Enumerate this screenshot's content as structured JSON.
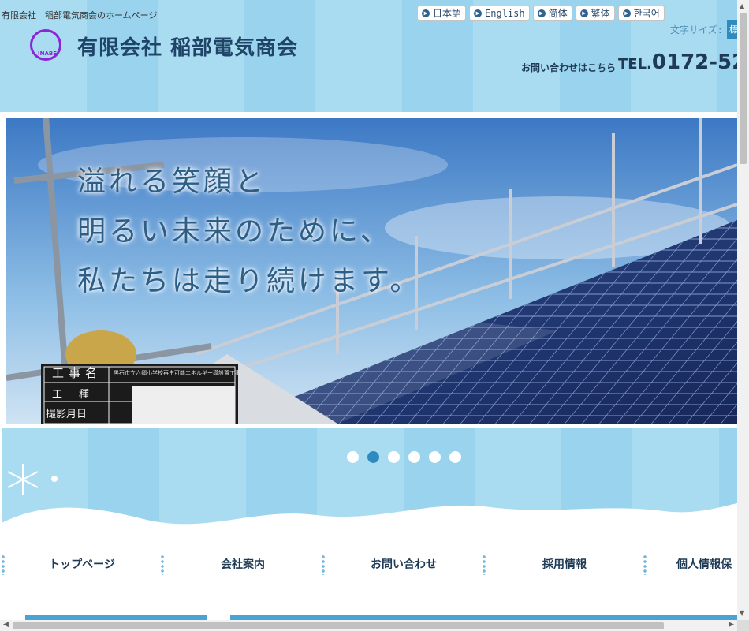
{
  "header": {
    "tagline": "有限会社　稲部電気商会のホームページ",
    "logo_text": "INABE",
    "company_name": "有限会社 稲部電気商会",
    "languages": [
      {
        "label": "日本語"
      },
      {
        "label": "English"
      },
      {
        "label": "简体"
      },
      {
        "label": "繁体"
      },
      {
        "label": "한국어"
      }
    ],
    "fontsize_label": "文字サイズ:",
    "fontsize_button": "標",
    "contact_label": "お問い合わせはこちら",
    "tel_prefix": "TEL.",
    "tel_number": "0172-52"
  },
  "hero": {
    "lines": [
      "溢れる笑顔と",
      "明るい未来のために、",
      "私たちは走り続けます。"
    ],
    "sign_title": "工事名",
    "sign_rows": [
      "工　種",
      "撮影月日"
    ],
    "sign_small": "黒石市立六郷小学校再生可能エネルギー導設置工事"
  },
  "slider": {
    "dots": 6,
    "active_index": 1
  },
  "nav": {
    "items": [
      {
        "label": "トップページ"
      },
      {
        "label": "会社案内"
      },
      {
        "label": "お問い合わせ"
      },
      {
        "label": "採用情報"
      },
      {
        "label": "個人情報保"
      }
    ]
  },
  "colors": {
    "header_bg": "#a9dcf1",
    "accent": "#2f8bbd",
    "text_dark": "#1f3a55",
    "logo_purple": "#8a25d8"
  }
}
